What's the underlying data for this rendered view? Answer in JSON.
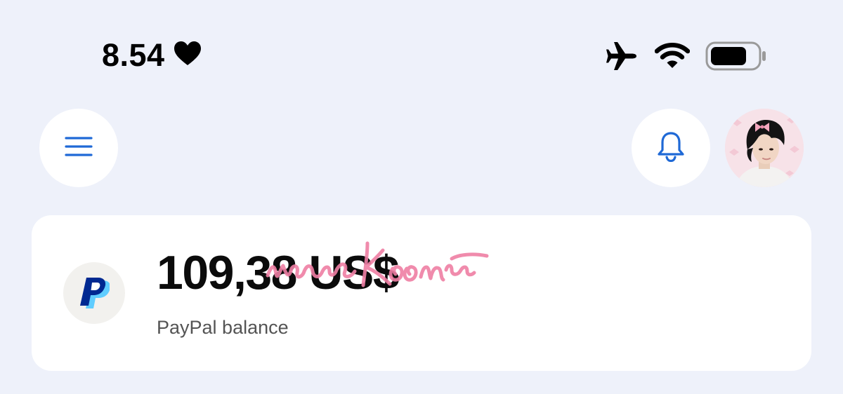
{
  "status_bar": {
    "time": "8.54",
    "icons": [
      "heart-icon",
      "airplane-icon",
      "wifi-icon",
      "battery-icon"
    ]
  },
  "header": {
    "menu_icon": "hamburger-menu-icon",
    "notification_icon": "bell-icon",
    "avatar": "profile-avatar"
  },
  "balance_card": {
    "amount": "109,38 US$",
    "label": "PayPal balance",
    "logo": "paypal-logo",
    "overlay": "pink-handwritten-signature"
  },
  "colors": {
    "background": "#eef1fa",
    "card": "#ffffff",
    "accent_blue": "#1f69d6",
    "paypal_dark": "#002991",
    "paypal_light": "#60cdff",
    "signature_pink": "#ef7fa4"
  }
}
